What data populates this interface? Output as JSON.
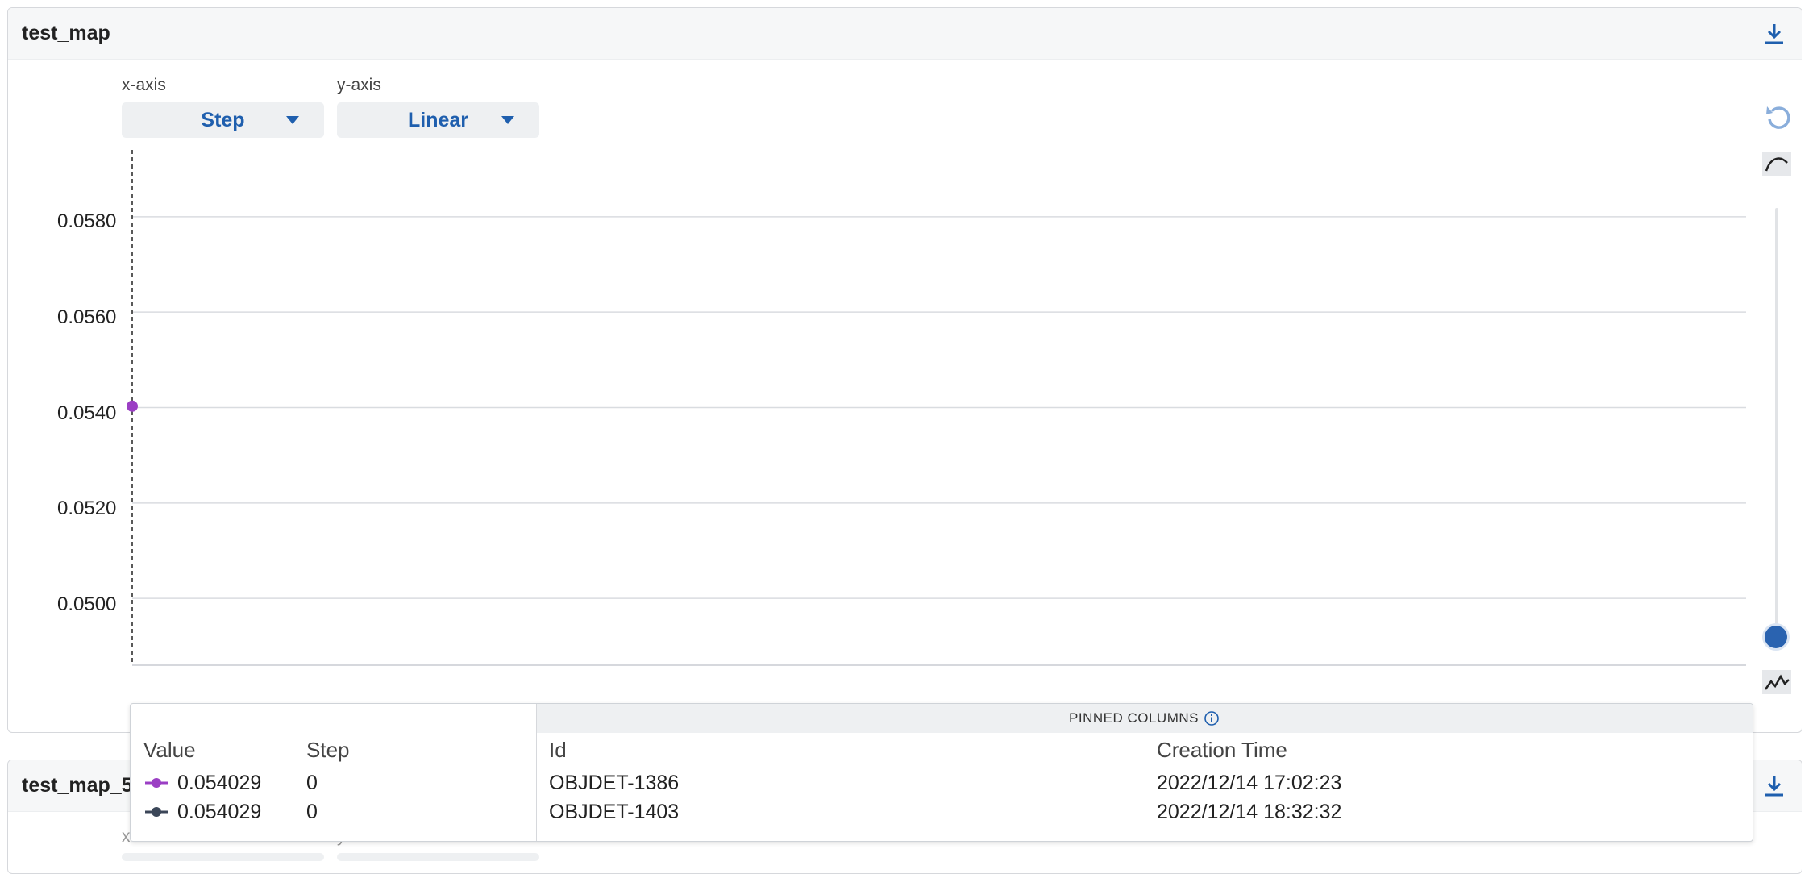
{
  "panel1": {
    "title": "test_map",
    "x_axis_label": "x-axis",
    "y_axis_label": "y-axis",
    "x_axis_value": "Step",
    "y_axis_value": "Linear",
    "y_ticks": [
      "0.0580",
      "0.0560",
      "0.0540",
      "0.0520",
      "0.0500"
    ]
  },
  "panel2": {
    "title": "test_map_5",
    "x_axis_label": "x-axis",
    "y_axis_label": "y-axis"
  },
  "tooltip": {
    "pinned_header": "PINNED COLUMNS",
    "columns": {
      "value": "Value",
      "step": "Step",
      "id": "Id",
      "creation_time": "Creation Time"
    },
    "rows": [
      {
        "value": "0.054029",
        "step": "0",
        "id": "OBJDET-1386",
        "creation_time": "2022/12/14 17:02:23",
        "color": "#9b3fc4"
      },
      {
        "value": "0.054029",
        "step": "0",
        "id": "OBJDET-1403",
        "creation_time": "2022/12/14 18:32:32",
        "color": "#3b4658"
      }
    ]
  },
  "chart_data": {
    "type": "line",
    "x": [
      0
    ],
    "series": [
      {
        "values": [
          0.054029
        ],
        "color": "#9b3fc4"
      }
    ],
    "xlabel": "",
    "ylabel": "",
    "ylim": [
      0.0486,
      0.0594
    ],
    "y_ticks": [
      0.058,
      0.056,
      0.054,
      0.052,
      0.05
    ],
    "grid": true
  },
  "colors": {
    "accent": "#1f5fae",
    "slider": "#2a63b0"
  },
  "icons": [
    "download-icon",
    "reset-icon",
    "smoothing-icon",
    "smoothing-off-icon",
    "caret-down-icon",
    "info-icon"
  ]
}
